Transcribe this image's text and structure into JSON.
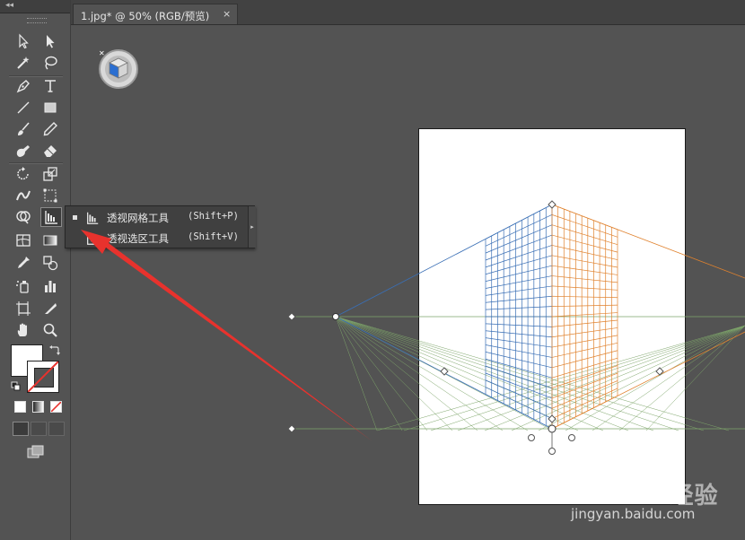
{
  "toolbar": {
    "collapse_glyph": "◂◂",
    "tools": [
      {
        "name": "selection-tool",
        "icon": "arrow-icon"
      },
      {
        "name": "direct-selection-tool",
        "icon": "white-arrow-icon"
      },
      {
        "name": "magic-wand-tool",
        "icon": "magic-wand-icon"
      },
      {
        "name": "lasso-tool",
        "icon": "lasso-icon"
      },
      {
        "name": "pen-tool",
        "icon": "pen-icon"
      },
      {
        "name": "type-tool",
        "icon": "type-icon"
      },
      {
        "name": "line-tool",
        "icon": "line-icon"
      },
      {
        "name": "rectangle-tool",
        "icon": "rectangle-icon"
      },
      {
        "name": "paintbrush-tool",
        "icon": "brush-icon"
      },
      {
        "name": "pencil-tool",
        "icon": "pencil-icon"
      },
      {
        "name": "blob-brush-tool",
        "icon": "blob-icon"
      },
      {
        "name": "eraser-tool",
        "icon": "eraser-icon"
      },
      {
        "name": "rotate-tool",
        "icon": "rotate-icon"
      },
      {
        "name": "scale-tool",
        "icon": "scale-icon"
      },
      {
        "name": "width-tool",
        "icon": "width-icon"
      },
      {
        "name": "free-transform-tool",
        "icon": "free-transform-icon"
      },
      {
        "name": "shape-builder-tool",
        "icon": "shape-builder-icon"
      },
      {
        "name": "perspective-grid-tool",
        "icon": "perspective-grid-icon"
      },
      {
        "name": "mesh-tool",
        "icon": "mesh-icon"
      },
      {
        "name": "gradient-tool",
        "icon": "gradient-icon"
      },
      {
        "name": "eyedropper-tool",
        "icon": "eyedropper-icon"
      },
      {
        "name": "blend-tool",
        "icon": "blend-icon"
      },
      {
        "name": "symbol-sprayer-tool",
        "icon": "symbol-sprayer-icon"
      },
      {
        "name": "column-graph-tool",
        "icon": "column-graph-icon"
      },
      {
        "name": "artboard-tool",
        "icon": "artboard-icon"
      },
      {
        "name": "slice-tool",
        "icon": "slice-icon"
      },
      {
        "name": "hand-tool",
        "icon": "hand-icon"
      },
      {
        "name": "zoom-tool",
        "icon": "zoom-icon"
      }
    ]
  },
  "document_tab": {
    "title": "1.jpg* @ 50% (RGB/预览)",
    "close_glyph": "×"
  },
  "flyout": {
    "items": [
      {
        "label": "透视网格工具",
        "shortcut": "(Shift+P)",
        "selected": true,
        "icon": "perspective-grid-icon"
      },
      {
        "label": "透视选区工具",
        "shortcut": "(Shift+V)",
        "selected": false,
        "icon": "perspective-selection-icon"
      }
    ],
    "tearoff_glyph": "▸"
  },
  "colors": {
    "ui_bg": "#535353",
    "left_grid": "#3a6fb5",
    "right_grid": "#e0822e",
    "ground_grid": "#7ea56a",
    "arrow": "#e8322d"
  },
  "watermark": {
    "logo_text": "Bai du 经验",
    "site": "jingyan.baidu.com"
  }
}
